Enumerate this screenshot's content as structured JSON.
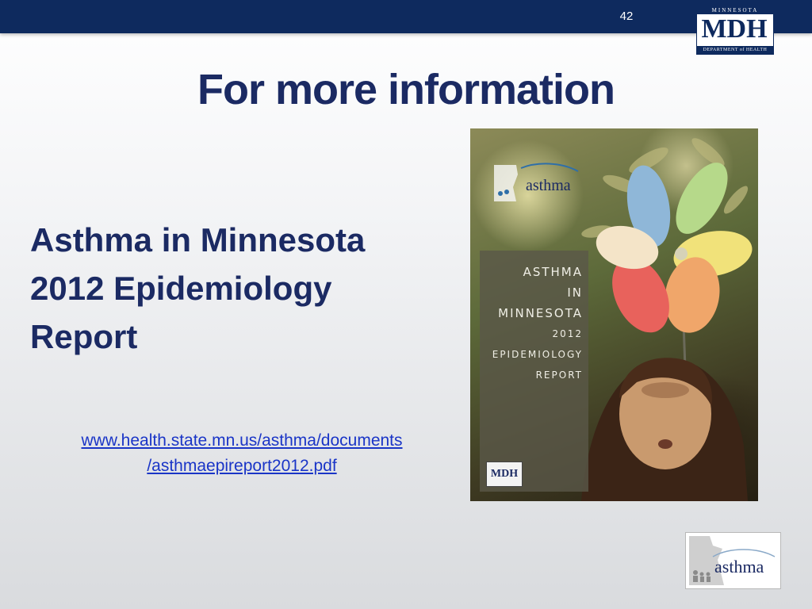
{
  "slide": {
    "number": "42",
    "title": "For more information"
  },
  "header_logo": {
    "top_text": "MINNESOTA",
    "main_text": "MDH",
    "bottom_text": "DEPARTMENT of HEALTH"
  },
  "report": {
    "title_lines": [
      "Asthma in Minnesota",
      "2012 Epidemiology",
      "Report"
    ],
    "link_lines": [
      "www.health.state.mn.us/asthma/documents",
      "/asthmaepireport2012.pdf"
    ]
  },
  "cover": {
    "lines": [
      "ASTHMA",
      "IN",
      "MINNESOTA",
      "2012",
      "EPIDEMIOLOGY",
      "REPORT"
    ],
    "badge_text": "asthma",
    "mdh_text": "MDH"
  },
  "bottom_logo": {
    "text": "asthma"
  },
  "colors": {
    "header_bar": "#0e2a5e",
    "title": "#1b2a63",
    "link": "#1a35c7"
  }
}
